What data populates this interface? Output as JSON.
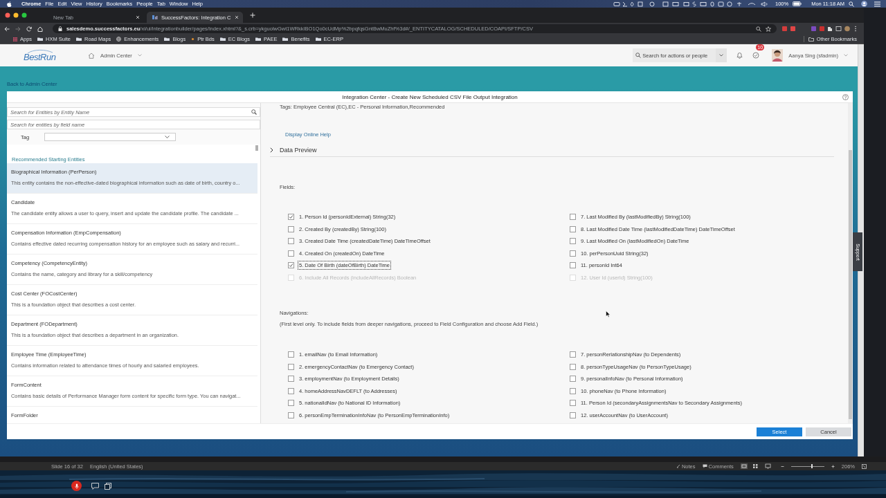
{
  "menu_bar": {
    "app": "Chrome",
    "menus": [
      "File",
      "Edit",
      "View",
      "History",
      "Bookmarks",
      "People",
      "Tab",
      "Window",
      "Help"
    ],
    "battery": "100%",
    "clock": "Mon 11:18 AM"
  },
  "browser": {
    "tabs": [
      {
        "label": "New Tab",
        "selected": false
      },
      {
        "label": "SuccessFactors: Integration C",
        "selected": true
      }
    ],
    "url": "**salesdemo.successfactors.eu**/xi/ui/integrationbuilder/pages/index.xhtml?&_s.crb=ykguolwGwt1WRkkIBO1Qo0cUdMp%2bpqfqsGntBwMuZhf%3d#/_ENTITYCATALOG/SCHEDULED/COAPI/SFTP/CSV",
    "bookmarks": [
      {
        "label": "Apps",
        "kind": "apps"
      },
      {
        "label": "HXM Suite",
        "kind": "folder"
      },
      {
        "label": "Road Maps",
        "kind": "folder"
      },
      {
        "label": "Enhancements",
        "kind": "site"
      },
      {
        "label": "Blogs",
        "kind": "folder"
      },
      {
        "label": "Ptr Bds",
        "kind": "page"
      },
      {
        "label": "EC Blogs",
        "kind": "folder"
      },
      {
        "label": "PAEE",
        "kind": "folder"
      },
      {
        "label": "Benefits",
        "kind": "folder"
      },
      {
        "label": "EC-ERP",
        "kind": "folder"
      }
    ],
    "other_bookmarks": "Other Bookmarks"
  },
  "header": {
    "logo": "BestRun",
    "nav": "Admin Center",
    "search_placeholder": "Search for actions or people",
    "notification_count": "10",
    "user": "Aanya Sing (sfadmin)"
  },
  "back_link": "Back to Admin Center",
  "dialog": {
    "title": "Integration Center - Create New Scheduled CSV File Output Integration",
    "entity_search_placeholder": "Search for Entities by Entity Name",
    "field_search_placeholder": "Search for entities by field name",
    "tag_label": "Tag",
    "section": "Recommended Starting Entities",
    "entities": [
      {
        "name": "Biographical Information (PerPerson)",
        "description": "This entity contains the non-effective-dated biographical information such as date of birth, country o...",
        "selected": true
      },
      {
        "name": "Candidate",
        "description": "The candidate entity allows a user to query, insert and update the candidate profile. The candidate ...",
        "selected": false
      },
      {
        "name": "Compensation Information (EmpCompensation)",
        "description": "Contains effective dated recurring compensation history for an employee such as salary and recurri...",
        "selected": false
      },
      {
        "name": "Competency (CompetencyEntity)",
        "description": "Contains the name, category and library for a skill/competency",
        "selected": false
      },
      {
        "name": "Cost Center (FOCostCenter)",
        "description": "This is a foundation object that describes a cost center.",
        "selected": false
      },
      {
        "name": "Department (FODepartment)",
        "description": "This is a foundation object that describes a department in an organization.",
        "selected": false
      },
      {
        "name": "Employee Time (EmployeeTime)",
        "description": "Contains information related to attendance times of hourly and salaried employees.",
        "selected": false
      },
      {
        "name": "FormContent",
        "description": "Contains basic details of Performance Manager form content for specific form type. You can navigat...",
        "selected": false
      },
      {
        "name": "FormFolder",
        "selected": false
      }
    ],
    "tags_line": "Tags: Employee Central (EC),EC - Personal Information,Recommended",
    "help_link": "Display Online Help",
    "data_preview": {
      "label": "Data Preview",
      "expanded": false
    },
    "fields_label": "Fields:",
    "fields": [
      {
        "label": "1. Person Id (personIdExternal) String(32)",
        "checked": true,
        "disabled": false,
        "focused": false
      },
      {
        "label": "2. Created By (createdBy) String(100)",
        "checked": false,
        "disabled": false,
        "focused": false
      },
      {
        "label": "3. Created Date Time (createdDateTime) DateTimeOffset",
        "checked": false,
        "disabled": false,
        "focused": false
      },
      {
        "label": "4. Created On (createdOn) DateTime",
        "checked": false,
        "disabled": false,
        "focused": false
      },
      {
        "label": "5. Date Of Birth (dateOfBirth) DateTime",
        "checked": true,
        "disabled": false,
        "focused": true
      },
      {
        "label": "6. Include All Records (includeAllRecords) Boolean",
        "checked": false,
        "disabled": true,
        "focused": false
      },
      {
        "label": "7. Last Modified By (lastModifiedBy) String(100)",
        "checked": false,
        "disabled": false,
        "focused": false
      },
      {
        "label": "8. Last Modified Date Time (lastModifiedDateTime) DateTimeOffset",
        "checked": false,
        "disabled": false,
        "focused": false
      },
      {
        "label": "9. Last Modified On (lastModifiedOn) DateTime",
        "checked": false,
        "disabled": false,
        "focused": false
      },
      {
        "label": "10. perPersonUuid String(32)",
        "checked": false,
        "disabled": false,
        "focused": false
      },
      {
        "label": "11. personId Int64",
        "checked": false,
        "disabled": false,
        "focused": false
      },
      {
        "label": "12. User Id (userId) String(100)",
        "checked": false,
        "disabled": true,
        "focused": false
      }
    ],
    "navigations_label": "Navigations:",
    "navigations_note": "(First level only. To include fields from deeper navigations, proceed to Field Configuration and choose Add Field.)",
    "navigations": [
      {
        "label": "1. emailNav (to Email Information)",
        "checked": false
      },
      {
        "label": "2. emergencyContactNav (to Emergency Contact)",
        "checked": false
      },
      {
        "label": "3. employmentNav (to Employment Details)",
        "checked": false
      },
      {
        "label": "4. homeAddressNavDEFLT (to Addresses)",
        "checked": false
      },
      {
        "label": "5. nationalIdNav (to National ID Information)",
        "checked": false
      },
      {
        "label": "6. personEmpTerminationInfoNav (to PersonEmpTerminationInfo)",
        "checked": false
      },
      {
        "label": "7. personRerlationshipNav (to Dependents)",
        "checked": false
      },
      {
        "label": "8. personTypeUsageNav (to PersonTypeUsage)",
        "checked": false
      },
      {
        "label": "9. personalInfoNav (to Personal Information)",
        "checked": false
      },
      {
        "label": "10. phoneNav (to Phone Information)",
        "checked": false
      },
      {
        "label": "11. Person Id (secondaryAssignmentsNav to Secondary Assignments)",
        "checked": false
      },
      {
        "label": "12. userAccountNav (to UserAccount)",
        "checked": false
      }
    ],
    "buttons": [
      "Select",
      "Cancel"
    ]
  },
  "side_tab": "Support",
  "status_bar": {
    "slide": "Slide 16 of 32",
    "language": "English (United States)",
    "notes": "Notes",
    "comments": "Comments",
    "zoom": "206%",
    "zoom_slider": {
      "level": 0.6
    }
  }
}
